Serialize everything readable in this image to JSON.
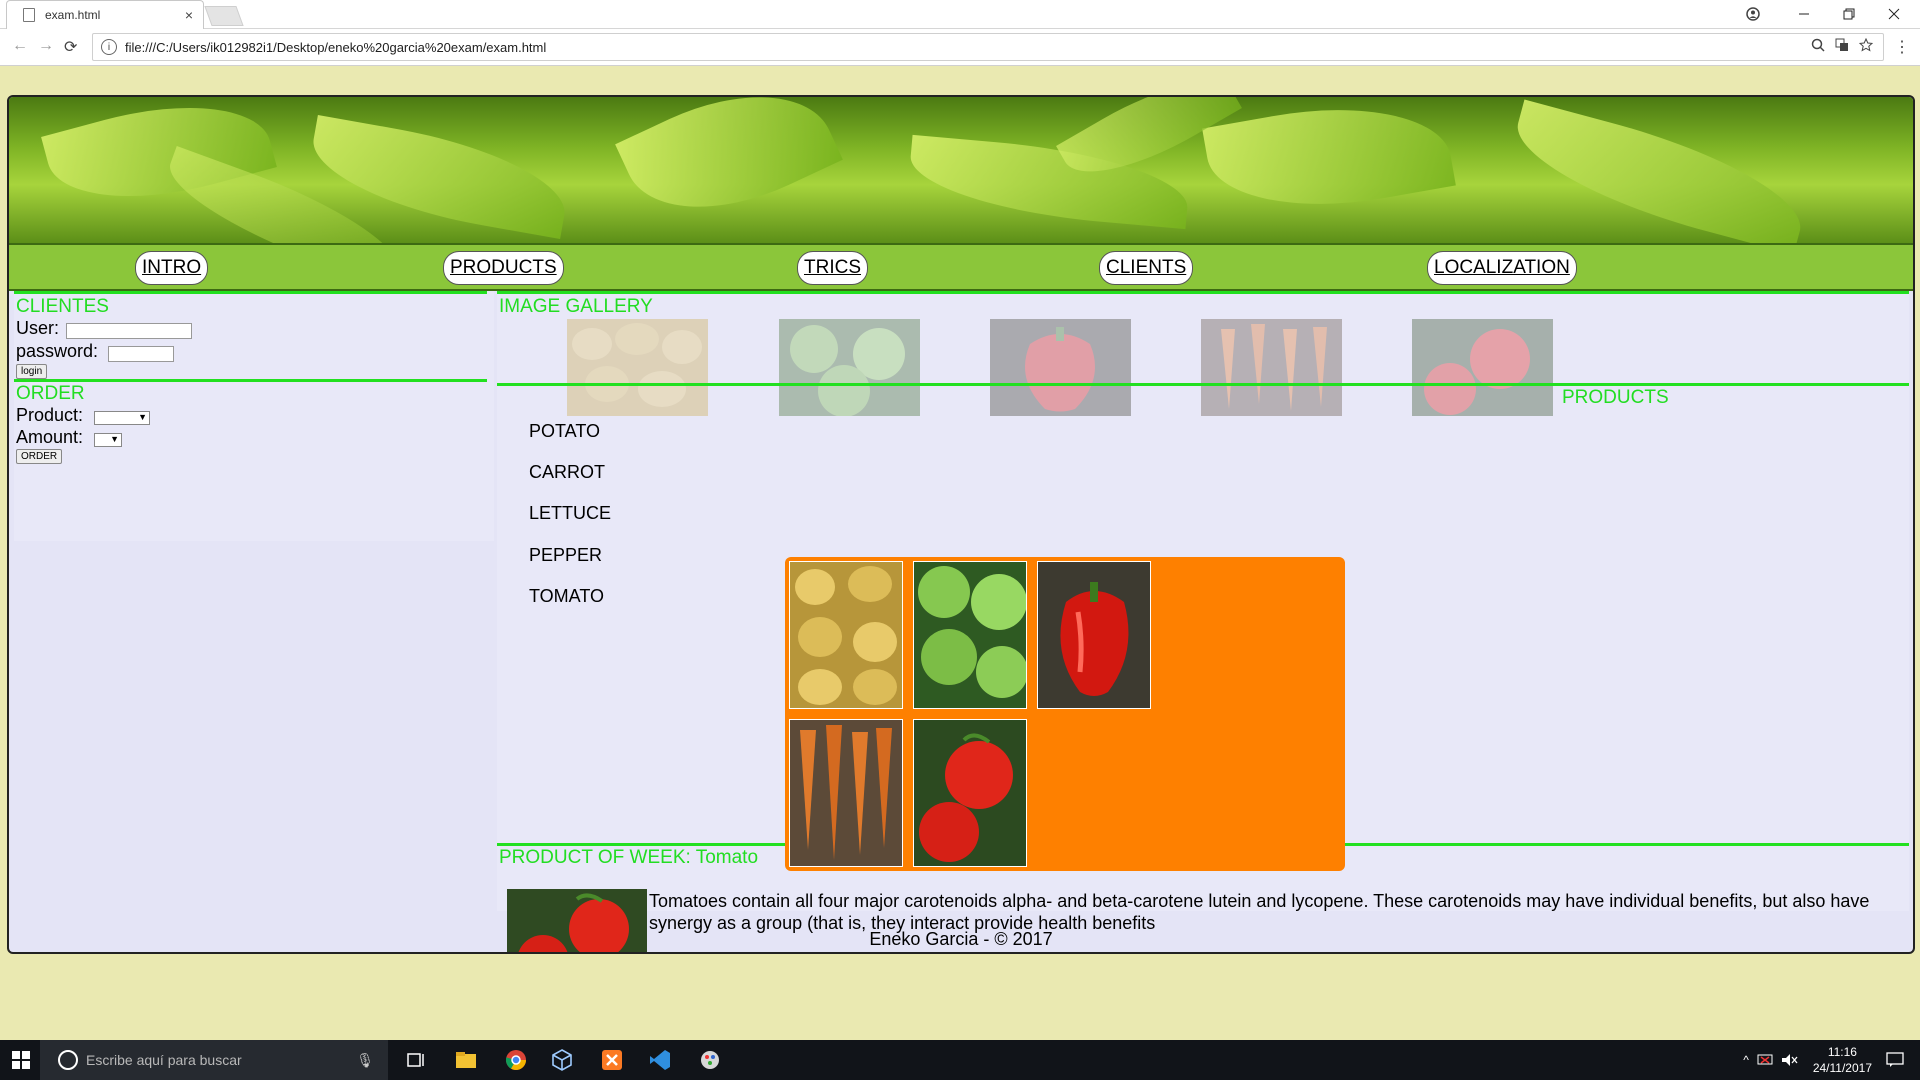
{
  "browser": {
    "tab_title": "exam.html",
    "tab_close": "×",
    "url": "file:///C:/Users/ik012982i1/Desktop/eneko%20garcia%20exam/exam.html",
    "info_symbol": "i"
  },
  "nav": {
    "items": [
      "INTRO",
      "PRODUCTS",
      "TRICS",
      "CLIENTS",
      "LOCALIZATION"
    ]
  },
  "sidebar": {
    "clientes_heading": "CLIENTES",
    "user_label": "User:",
    "password_label": "password:",
    "login_label": "login",
    "order_heading": "ORDER",
    "product_label": "Product:",
    "amount_label": "Amount:",
    "order_button": "ORDER"
  },
  "main": {
    "gallery_heading": "IMAGE GALLERY",
    "products_heading": "PRODUCTS",
    "products": [
      "POTATO",
      "CARROT",
      "LETTUCE",
      "PEPPER",
      "TOMATO"
    ],
    "product_of_week": "PRODUCT OF WEEK: Tomato",
    "description": "Tomatoes contain all four major carotenoids alpha- and beta-carotene lutein and lycopene. These carotenoids may have individual benefits, but also have synergy as a group (that is, they interact provide health benefits"
  },
  "footer": {
    "text": "Eneko Garcia - © 2017"
  },
  "taskbar": {
    "search_placeholder": "Escribe aquí para buscar",
    "time": "11:16",
    "date": "24/11/2017"
  },
  "colors": {
    "accent_green": "#22e020",
    "navbar_green": "#8bc63a",
    "orange_panel": "#fe8000",
    "page_bg": "#e4e4f6",
    "body_bg": "#eae9b1"
  }
}
